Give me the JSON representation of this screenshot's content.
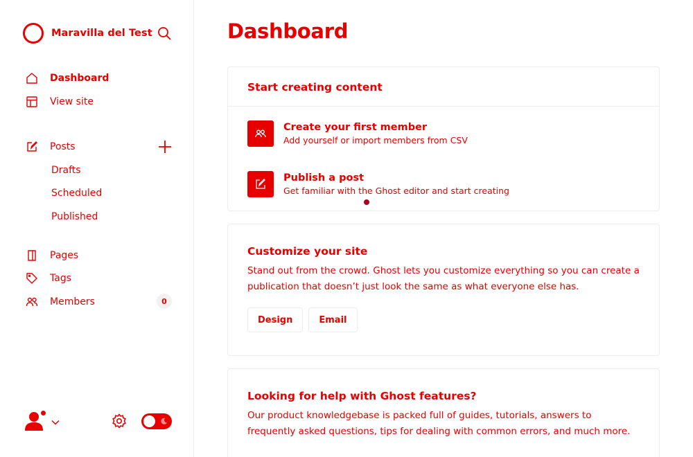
{
  "brand": {
    "name": "Maravilla del Test"
  },
  "nav": {
    "dashboard": "Dashboard",
    "view_site": "View site",
    "posts": "Posts",
    "drafts": "Drafts",
    "scheduled": "Scheduled",
    "published": "Published",
    "pages": "Pages",
    "tags": "Tags",
    "members": "Members",
    "members_count": "0"
  },
  "main": {
    "title": "Dashboard",
    "start": {
      "heading": "Start creating content",
      "tasks": [
        {
          "title": "Create your first member",
          "desc": "Add yourself or import members from CSV",
          "icon": "members-icon"
        },
        {
          "title": "Publish a post",
          "desc": "Get familiar with the Ghost editor and start creating",
          "icon": "edit-icon"
        }
      ]
    },
    "customize": {
      "heading": "Customize your site",
      "body": "Stand out from the crowd. Ghost lets you customize everything so you can create a publication that doesn’t just look the same as what everyone else has.",
      "buttons": [
        "Design",
        "Email"
      ]
    },
    "help": {
      "heading": "Looking for help with Ghost features?",
      "body": "Our product knowledgebase is packed full of guides, tutorials, answers to frequently asked questions, tips for dealing with common errors, and much more."
    }
  },
  "colors": {
    "accent": "#e60000",
    "border": "#ececec"
  }
}
